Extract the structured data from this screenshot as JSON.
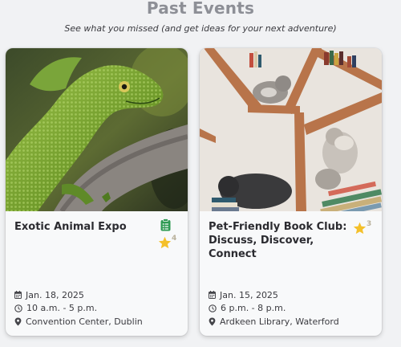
{
  "header": {
    "title": "Past Events",
    "subtitle": "See what you missed (and get ideas for your next adventure)"
  },
  "events": [
    {
      "title": "Exotic Animal Expo",
      "rating_count": "4",
      "date": "Jan. 18, 2025",
      "time": "10 a.m. - 5 p.m.",
      "location": "Convention Center, Dublin",
      "image": "green lizard on a branch"
    },
    {
      "title": "Pet-Friendly Book Club: Discuss, Discover, Connect",
      "rating_count": "3",
      "date": "Jan. 15, 2025",
      "time": "6 p.m. - 8 p.m.",
      "location": "Ardkeen Library, Waterford",
      "image": "kittens on a tree-shaped bookshelf"
    }
  ],
  "colors": {
    "star": "#f4c02a",
    "clipboard": "#2e9a53",
    "title": "#8d8f96"
  },
  "icons": [
    "calendar-icon",
    "clock-icon",
    "location-pin-icon",
    "star-icon",
    "clipboard-list-icon"
  ]
}
